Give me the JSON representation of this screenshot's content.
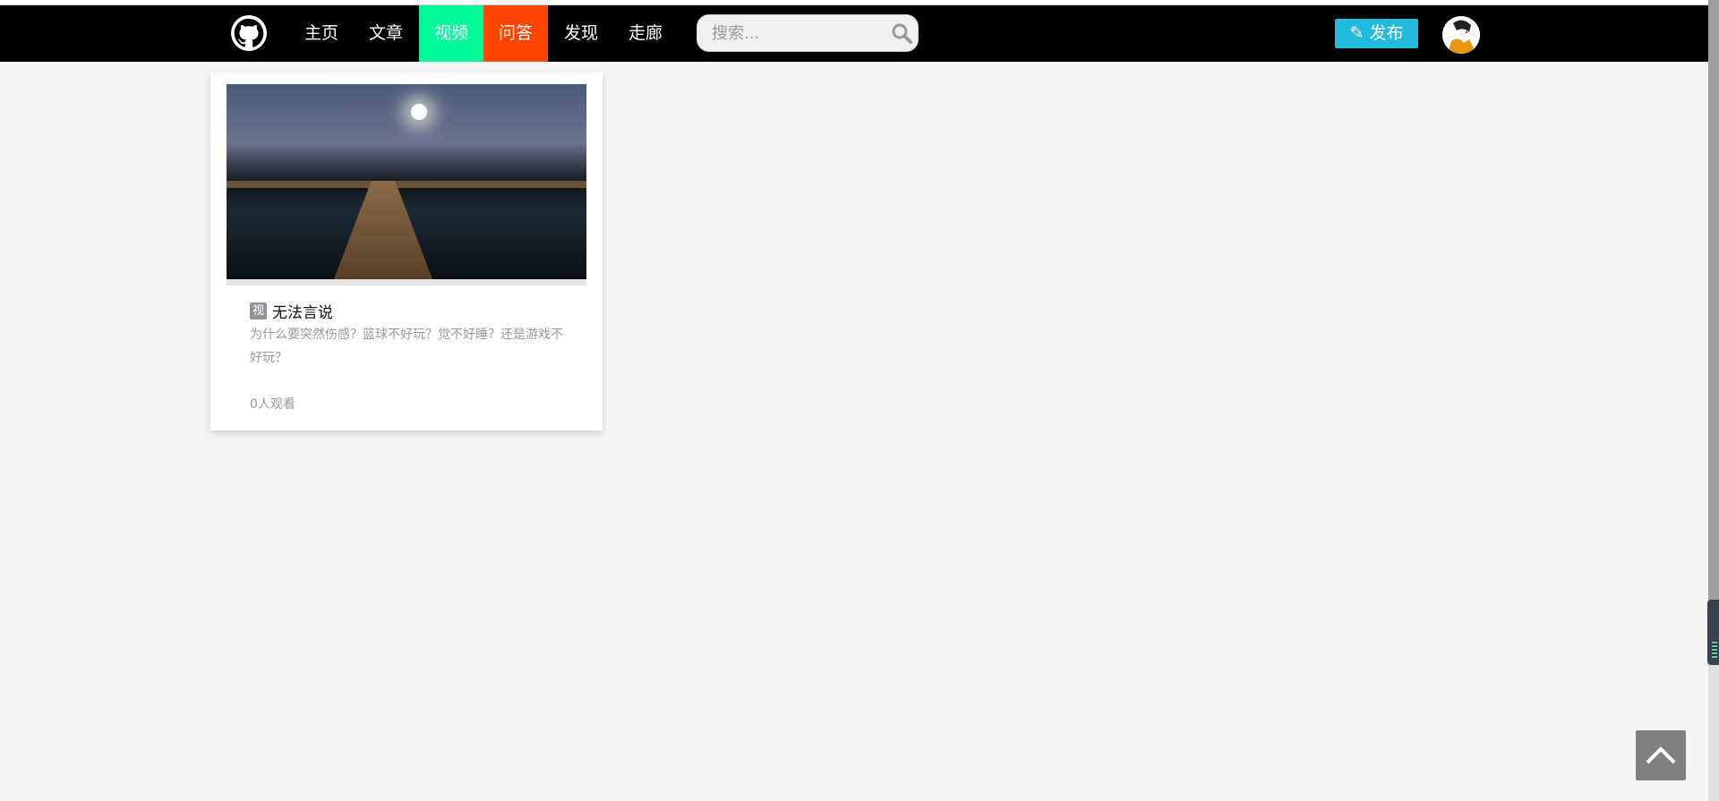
{
  "nav": {
    "items": [
      {
        "label": "主页",
        "bg": null
      },
      {
        "label": "文章",
        "bg": null
      },
      {
        "label": "视频",
        "bg": "#00fa9a"
      },
      {
        "label": "问答",
        "bg": "#ff4500"
      },
      {
        "label": "发现",
        "bg": null
      },
      {
        "label": "走廊",
        "bg": null
      }
    ],
    "search_placeholder": "搜索...",
    "publish_label": "发布",
    "publish_color": "#22bbdd"
  },
  "card": {
    "badge": "视",
    "title": "无法言说",
    "description": "为什么要突然伤感？篮球不好玩？觉不好睡？还是游戏不好玩？",
    "views": "0人观看"
  }
}
